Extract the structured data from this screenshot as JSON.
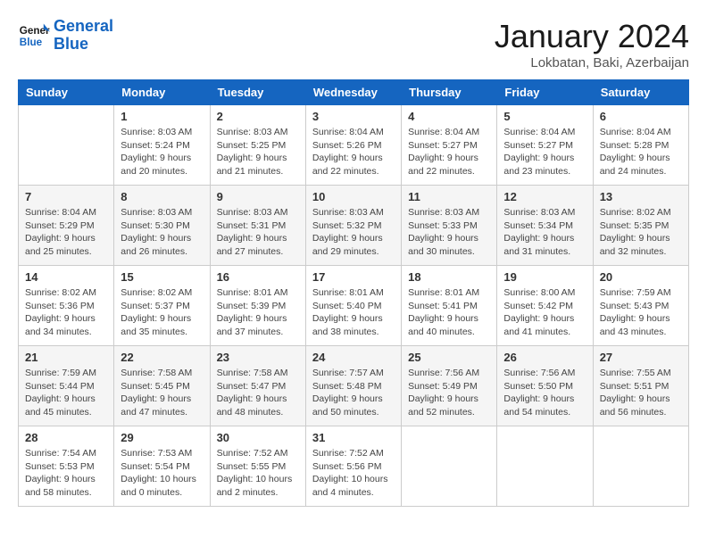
{
  "header": {
    "logo_line1": "General",
    "logo_line2": "Blue",
    "month_title": "January 2024",
    "location": "Lokbatan, Baki, Azerbaijan"
  },
  "weekdays": [
    "Sunday",
    "Monday",
    "Tuesday",
    "Wednesday",
    "Thursday",
    "Friday",
    "Saturday"
  ],
  "weeks": [
    [
      {
        "day": "",
        "info": ""
      },
      {
        "day": "1",
        "info": "Sunrise: 8:03 AM\nSunset: 5:24 PM\nDaylight: 9 hours\nand 20 minutes."
      },
      {
        "day": "2",
        "info": "Sunrise: 8:03 AM\nSunset: 5:25 PM\nDaylight: 9 hours\nand 21 minutes."
      },
      {
        "day": "3",
        "info": "Sunrise: 8:04 AM\nSunset: 5:26 PM\nDaylight: 9 hours\nand 22 minutes."
      },
      {
        "day": "4",
        "info": "Sunrise: 8:04 AM\nSunset: 5:27 PM\nDaylight: 9 hours\nand 22 minutes."
      },
      {
        "day": "5",
        "info": "Sunrise: 8:04 AM\nSunset: 5:27 PM\nDaylight: 9 hours\nand 23 minutes."
      },
      {
        "day": "6",
        "info": "Sunrise: 8:04 AM\nSunset: 5:28 PM\nDaylight: 9 hours\nand 24 minutes."
      }
    ],
    [
      {
        "day": "7",
        "info": "Sunrise: 8:04 AM\nSunset: 5:29 PM\nDaylight: 9 hours\nand 25 minutes."
      },
      {
        "day": "8",
        "info": "Sunrise: 8:03 AM\nSunset: 5:30 PM\nDaylight: 9 hours\nand 26 minutes."
      },
      {
        "day": "9",
        "info": "Sunrise: 8:03 AM\nSunset: 5:31 PM\nDaylight: 9 hours\nand 27 minutes."
      },
      {
        "day": "10",
        "info": "Sunrise: 8:03 AM\nSunset: 5:32 PM\nDaylight: 9 hours\nand 29 minutes."
      },
      {
        "day": "11",
        "info": "Sunrise: 8:03 AM\nSunset: 5:33 PM\nDaylight: 9 hours\nand 30 minutes."
      },
      {
        "day": "12",
        "info": "Sunrise: 8:03 AM\nSunset: 5:34 PM\nDaylight: 9 hours\nand 31 minutes."
      },
      {
        "day": "13",
        "info": "Sunrise: 8:02 AM\nSunset: 5:35 PM\nDaylight: 9 hours\nand 32 minutes."
      }
    ],
    [
      {
        "day": "14",
        "info": "Sunrise: 8:02 AM\nSunset: 5:36 PM\nDaylight: 9 hours\nand 34 minutes."
      },
      {
        "day": "15",
        "info": "Sunrise: 8:02 AM\nSunset: 5:37 PM\nDaylight: 9 hours\nand 35 minutes."
      },
      {
        "day": "16",
        "info": "Sunrise: 8:01 AM\nSunset: 5:39 PM\nDaylight: 9 hours\nand 37 minutes."
      },
      {
        "day": "17",
        "info": "Sunrise: 8:01 AM\nSunset: 5:40 PM\nDaylight: 9 hours\nand 38 minutes."
      },
      {
        "day": "18",
        "info": "Sunrise: 8:01 AM\nSunset: 5:41 PM\nDaylight: 9 hours\nand 40 minutes."
      },
      {
        "day": "19",
        "info": "Sunrise: 8:00 AM\nSunset: 5:42 PM\nDaylight: 9 hours\nand 41 minutes."
      },
      {
        "day": "20",
        "info": "Sunrise: 7:59 AM\nSunset: 5:43 PM\nDaylight: 9 hours\nand 43 minutes."
      }
    ],
    [
      {
        "day": "21",
        "info": "Sunrise: 7:59 AM\nSunset: 5:44 PM\nDaylight: 9 hours\nand 45 minutes."
      },
      {
        "day": "22",
        "info": "Sunrise: 7:58 AM\nSunset: 5:45 PM\nDaylight: 9 hours\nand 47 minutes."
      },
      {
        "day": "23",
        "info": "Sunrise: 7:58 AM\nSunset: 5:47 PM\nDaylight: 9 hours\nand 48 minutes."
      },
      {
        "day": "24",
        "info": "Sunrise: 7:57 AM\nSunset: 5:48 PM\nDaylight: 9 hours\nand 50 minutes."
      },
      {
        "day": "25",
        "info": "Sunrise: 7:56 AM\nSunset: 5:49 PM\nDaylight: 9 hours\nand 52 minutes."
      },
      {
        "day": "26",
        "info": "Sunrise: 7:56 AM\nSunset: 5:50 PM\nDaylight: 9 hours\nand 54 minutes."
      },
      {
        "day": "27",
        "info": "Sunrise: 7:55 AM\nSunset: 5:51 PM\nDaylight: 9 hours\nand 56 minutes."
      }
    ],
    [
      {
        "day": "28",
        "info": "Sunrise: 7:54 AM\nSunset: 5:53 PM\nDaylight: 9 hours\nand 58 minutes."
      },
      {
        "day": "29",
        "info": "Sunrise: 7:53 AM\nSunset: 5:54 PM\nDaylight: 10 hours\nand 0 minutes."
      },
      {
        "day": "30",
        "info": "Sunrise: 7:52 AM\nSunset: 5:55 PM\nDaylight: 10 hours\nand 2 minutes."
      },
      {
        "day": "31",
        "info": "Sunrise: 7:52 AM\nSunset: 5:56 PM\nDaylight: 10 hours\nand 4 minutes."
      },
      {
        "day": "",
        "info": ""
      },
      {
        "day": "",
        "info": ""
      },
      {
        "day": "",
        "info": ""
      }
    ]
  ]
}
